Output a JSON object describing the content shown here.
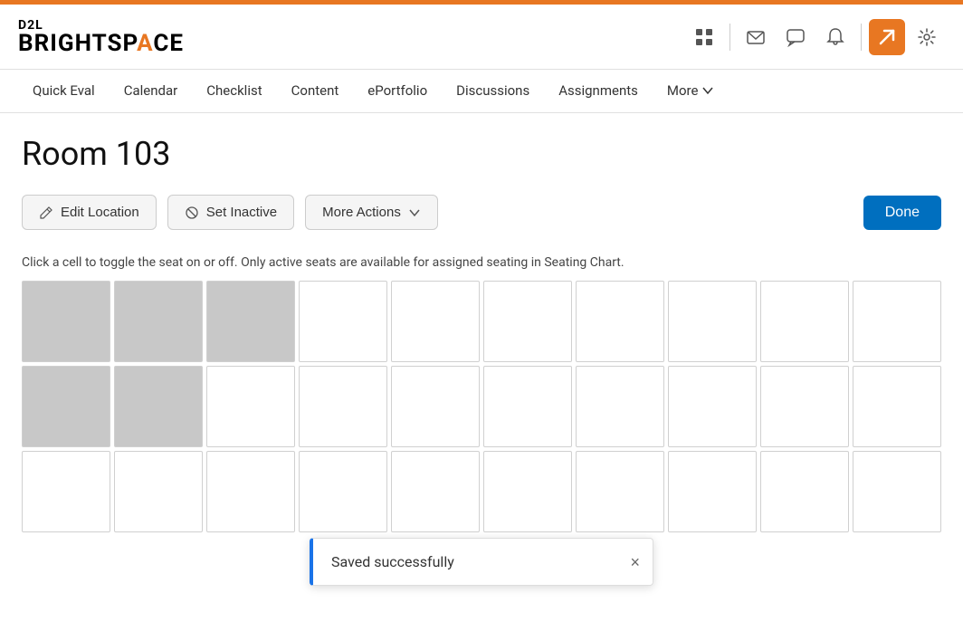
{
  "topbar": {
    "brand": {
      "d2l": "D2L",
      "brightspace_pre": "BRIGHTSP",
      "brightspace_accent": "A",
      "brightspace_post": "CE"
    }
  },
  "header": {
    "icons": [
      {
        "name": "grid-icon",
        "symbol": "⊞",
        "label": "Apps"
      },
      {
        "name": "mail-icon",
        "symbol": "✉",
        "label": "Mail"
      },
      {
        "name": "chat-icon",
        "symbol": "💬",
        "label": "Chat"
      },
      {
        "name": "bell-icon",
        "symbol": "🔔",
        "label": "Notifications"
      },
      {
        "name": "profile-icon",
        "symbol": "↗",
        "label": "Profile",
        "active": true
      },
      {
        "name": "settings-icon",
        "symbol": "⚙",
        "label": "Settings"
      }
    ]
  },
  "nav": {
    "items": [
      {
        "id": "quick-eval",
        "label": "Quick Eval"
      },
      {
        "id": "calendar",
        "label": "Calendar"
      },
      {
        "id": "checklist",
        "label": "Checklist"
      },
      {
        "id": "content",
        "label": "Content"
      },
      {
        "id": "eportfolio",
        "label": "ePortfolio"
      },
      {
        "id": "discussions",
        "label": "Discussions"
      },
      {
        "id": "assignments",
        "label": "Assignments"
      },
      {
        "id": "more",
        "label": "More",
        "hasDropdown": true
      }
    ]
  },
  "main": {
    "page_title": "Room 103",
    "actions": {
      "edit_location": "Edit Location",
      "set_inactive": "Set Inactive",
      "more_actions": "More Actions",
      "done": "Done"
    },
    "instruction": "Click a cell to toggle the seat on or off. Only active seats are available for assigned seating in Seating Chart.",
    "grid": {
      "rows": 3,
      "cols": 10,
      "inactive_cells": [
        "0-0",
        "0-1",
        "0-2",
        "1-0",
        "1-1"
      ]
    }
  },
  "toast": {
    "message": "Saved successfully",
    "close_label": "×"
  },
  "colors": {
    "orange": "#e87722",
    "blue": "#006fbf",
    "inactive_cell": "#c8c8c8"
  }
}
